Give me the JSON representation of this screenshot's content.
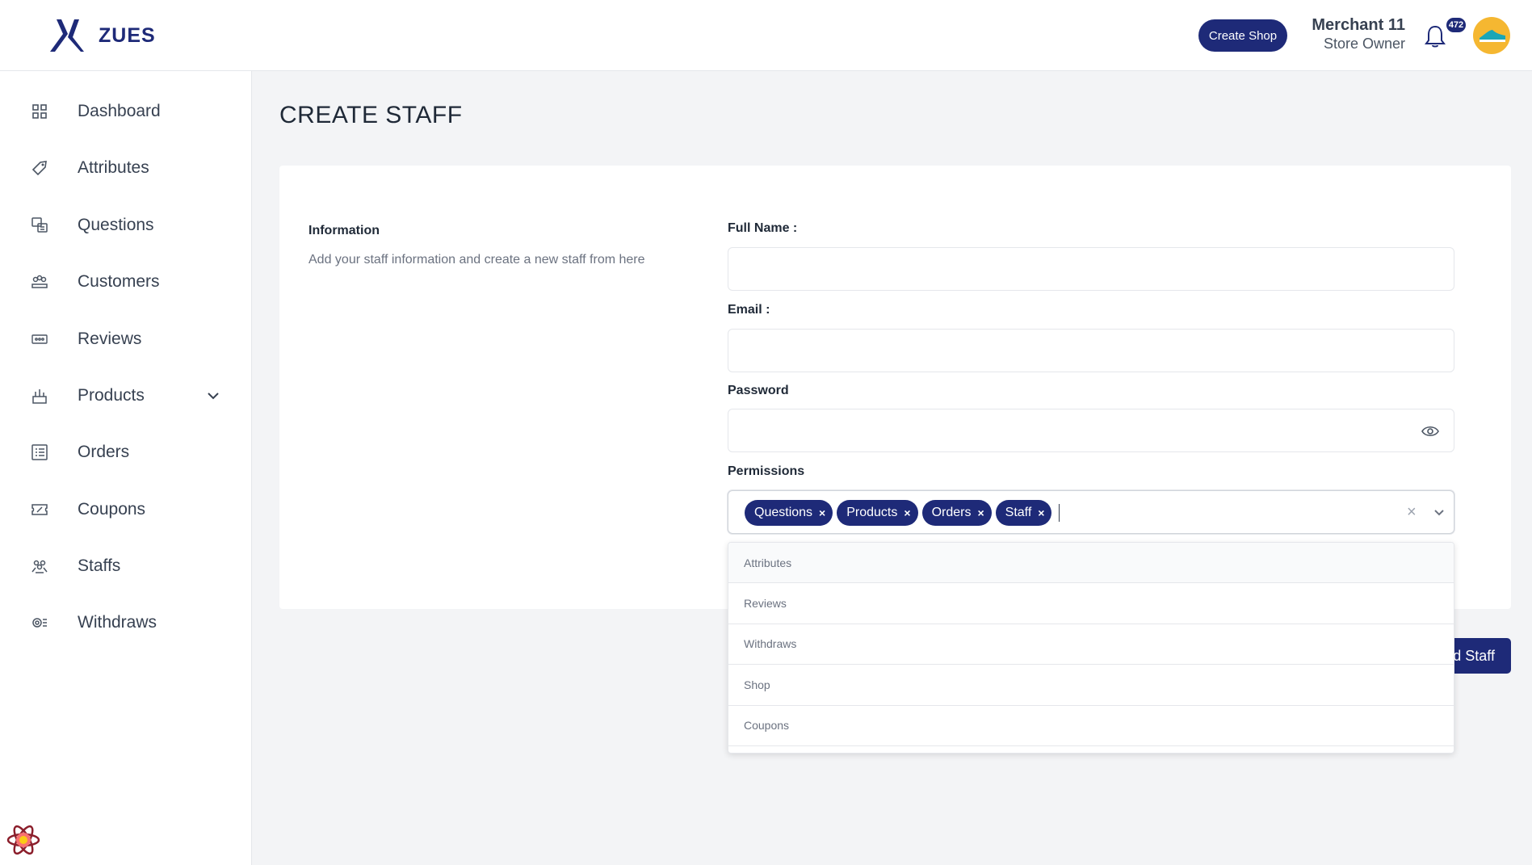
{
  "header": {
    "logo_text": "ZUES",
    "create_shop_label": "Create Shop",
    "user_name": "Merchant 11",
    "user_role": "Store Owner",
    "notification_count": "472"
  },
  "sidebar": {
    "items": [
      {
        "label": "Dashboard",
        "icon": "dashboard-icon"
      },
      {
        "label": "Attributes",
        "icon": "tag-icon"
      },
      {
        "label": "Questions",
        "icon": "questions-icon"
      },
      {
        "label": "Customers",
        "icon": "customers-icon"
      },
      {
        "label": "Reviews",
        "icon": "reviews-icon"
      },
      {
        "label": "Products",
        "icon": "products-icon"
      },
      {
        "label": "Orders",
        "icon": "orders-icon"
      },
      {
        "label": "Coupons",
        "icon": "coupon-icon"
      },
      {
        "label": "Staffs",
        "icon": "staffs-icon"
      },
      {
        "label": "Withdraws",
        "icon": "withdraws-icon"
      }
    ]
  },
  "page": {
    "title": "CREATE STAFF"
  },
  "form": {
    "info_title": "Information",
    "info_description": "Add your staff information and create a new staff from here",
    "full_name_label": "Full Name :",
    "full_name_value": "",
    "email_label": "Email :",
    "email_value": "",
    "password_label": "Password",
    "password_value": "",
    "permissions_label": "Permissions",
    "selected_permissions": [
      "Questions",
      "Products",
      "Orders",
      "Staff"
    ],
    "chip_remove": "×",
    "clear_symbol": "×",
    "dropdown_options": [
      "Attributes",
      "Reviews",
      "Withdraws",
      "Shop",
      "Coupons"
    ],
    "submit_label": "d Staff"
  },
  "colors": {
    "primary": "#1e2a78",
    "background": "#f3f4f6",
    "avatar": "#f5b731"
  }
}
